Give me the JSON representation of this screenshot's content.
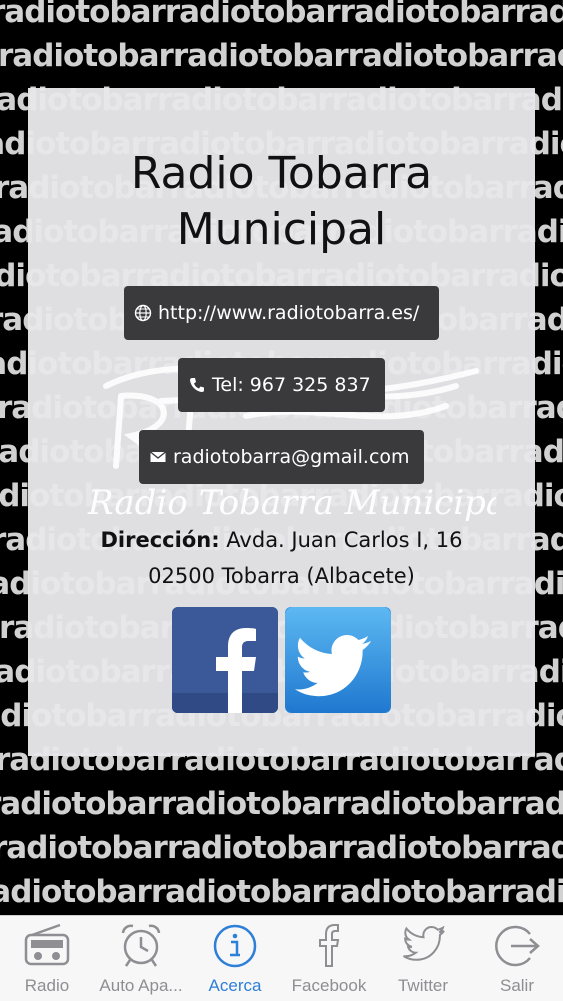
{
  "background_text": "radiotobarradiotobarradiotobarradiotobarradiotobarradiotobarradiotobarradiotobarradiotobarradiotobarradiotobarra",
  "station": {
    "title_line1": "Radio Tobarra",
    "title_line2": "Municipal",
    "website": "http://www.radiotobarra.es/",
    "phone": "Tel: 967 325 837",
    "email": "radiotobarra@gmail.com",
    "address_label": "Dirección:",
    "address_line1": "Avda. Juan Carlos I, 16",
    "address_line2": "02500 Tobarra (Albacete)",
    "watermark_text": "Radio Tobarra Municipal"
  },
  "tabs": [
    {
      "label": "Radio",
      "icon": "radio-icon"
    },
    {
      "label": "Auto Apa...",
      "icon": "alarm-clock-icon"
    },
    {
      "label": "Acerca",
      "icon": "info-icon",
      "active": true
    },
    {
      "label": "Facebook",
      "icon": "facebook-icon"
    },
    {
      "label": "Twitter",
      "icon": "twitter-icon"
    },
    {
      "label": "Salir",
      "icon": "exit-icon"
    }
  ],
  "colors": {
    "accent": "#2e7fd8",
    "pill": "#3a3a3c",
    "facebook": "#3b5998",
    "twitter": "#2f8fe0"
  }
}
